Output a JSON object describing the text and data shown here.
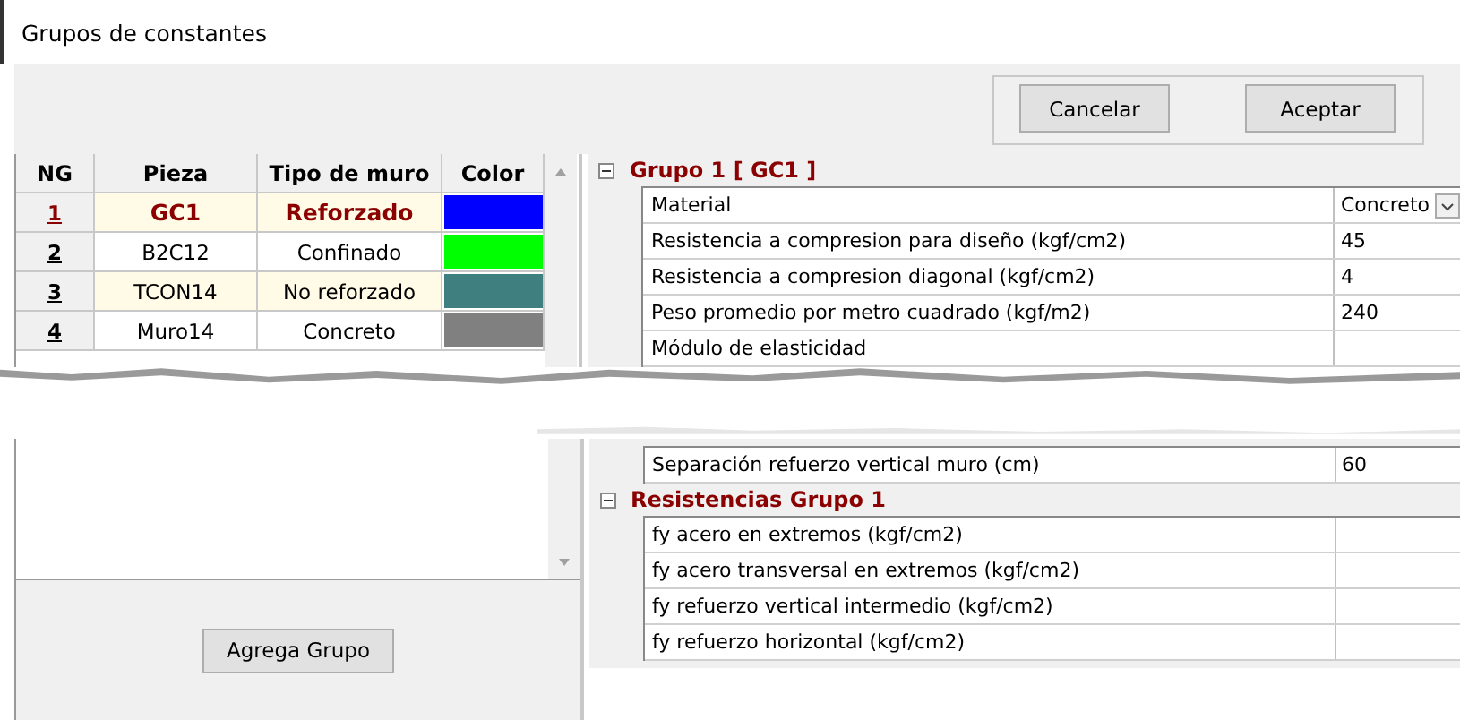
{
  "window": {
    "title": "Grupos de constantes"
  },
  "buttons": [
    {
      "label": "Cancelar"
    },
    {
      "label": "Aceptar"
    }
  ],
  "table": {
    "columns": [
      "NG",
      "Pieza",
      "Tipo de muro",
      "Color"
    ],
    "rows": [
      {
        "ng": "1",
        "pieza": "GC1",
        "tipo": "Reforzado",
        "color": "#0000ff",
        "selected": true
      },
      {
        "ng": "2",
        "pieza": "B2C12",
        "tipo": "Confinado",
        "color": "#00ff00",
        "selected": false
      },
      {
        "ng": "3",
        "pieza": "TCON14",
        "tipo": "No reforzado",
        "color": "#3f7f7f",
        "selected": false
      },
      {
        "ng": "4",
        "pieza": "Muro14",
        "tipo": "Concreto",
        "color": "#808080",
        "selected": false
      }
    ]
  },
  "add_button": {
    "label": "Agrega Grupo"
  },
  "groups": [
    {
      "title": "Grupo 1 [ GC1  ]",
      "expanded": true,
      "rows_before_tear": [
        {
          "label": "Material",
          "value": "Concreto",
          "kind": "dropdown"
        },
        {
          "label": "Resistencia a compresion para diseño (kgf/cm2)",
          "value": "45",
          "kind": "text"
        },
        {
          "label": "Resistencia a compresion diagonal (kgf/cm2)",
          "value": "4",
          "kind": "text"
        },
        {
          "label": "Peso promedio por metro cuadrado (kgf/m2)",
          "value": "240",
          "kind": "text"
        },
        {
          "label": "Módulo de elasticidad",
          "kind": "text"
        }
      ],
      "rows_after_tear": [
        {
          "label": "Separación refuerzo vertical muro (cm)",
          "value": "60"
        }
      ]
    },
    {
      "title": "Resistencias Grupo 1",
      "expanded": true,
      "rows_after_tear": [
        {
          "label": "fy acero en extremos (kgf/cm2)"
        },
        {
          "label": "fy acero transversal en extremos (kgf/cm2)"
        },
        {
          "label": "fy refuerzo vertical intermedio (kgf/cm2)"
        },
        {
          "label": "fy refuerzo horizontal (kgf/cm2)"
        }
      ]
    }
  ]
}
